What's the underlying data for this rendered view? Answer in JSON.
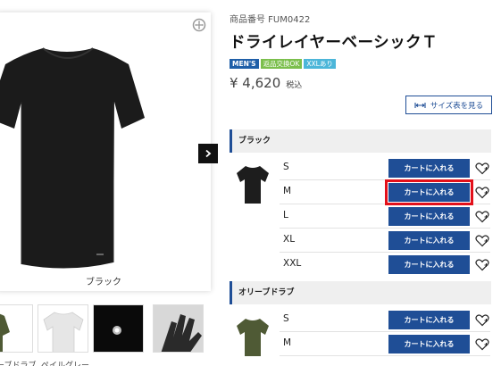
{
  "gallery": {
    "main_caption": "ブラック",
    "thumbnails": [
      {
        "caption": "ーブドラブ"
      },
      {
        "caption": "ペイルグレー"
      },
      {
        "caption": ""
      },
      {
        "caption": ""
      }
    ]
  },
  "product": {
    "number_label": "商品番号 FUM0422",
    "title": "ドライレイヤーベーシックＴ",
    "tags": [
      "MEN'S",
      "返品交換OK",
      "XXLあり"
    ],
    "price": "¥ 4,620",
    "tax_label": "税込",
    "size_chart_label": "サイズ表を見る"
  },
  "colors": [
    {
      "name": "ブラック",
      "sizes": [
        {
          "size": "S",
          "cart_label": "カートに入れる"
        },
        {
          "size": "M",
          "cart_label": "カートに入れる"
        },
        {
          "size": "L",
          "cart_label": "カートに入れる"
        },
        {
          "size": "XL",
          "cart_label": "カートに入れる"
        },
        {
          "size": "XXL",
          "cart_label": "カートに入れる"
        }
      ]
    },
    {
      "name": "オリーブドラブ",
      "sizes": [
        {
          "size": "S",
          "cart_label": "カートに入れる"
        },
        {
          "size": "M",
          "cart_label": "カートに入れる"
        }
      ]
    }
  ],
  "colors_hex": {
    "accent": "#1f4e96",
    "highlight": "#e3101a"
  }
}
